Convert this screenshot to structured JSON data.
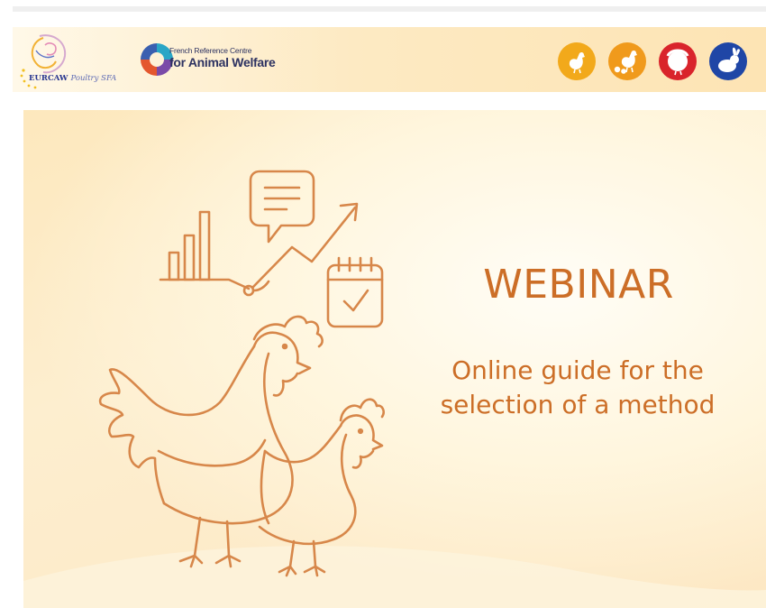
{
  "header": {
    "eurcaw_logo": {
      "name": "EURCAW",
      "suffix": "Poultry SFA"
    },
    "frcaw_logo": {
      "line1": "French Reference Centre",
      "line2": "for Animal Welfare"
    },
    "species_icons": [
      {
        "icon": "hen-icon",
        "color": "#f2a91b"
      },
      {
        "icon": "hen-with-chicks-icon",
        "color": "#f09a1c"
      },
      {
        "icon": "turkey-icon",
        "color": "#d9242b"
      },
      {
        "icon": "rabbit-icon",
        "color": "#1f46a6"
      }
    ]
  },
  "slide": {
    "title": "WEBINAR",
    "subtitle_line1": "Online guide for the",
    "subtitle_line2": "selection of a method",
    "accent_color": "#cc6e27"
  }
}
